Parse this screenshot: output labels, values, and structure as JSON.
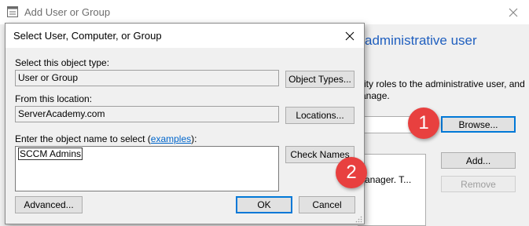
{
  "background_window": {
    "title": "Add User or Group",
    "heading": "administrative user",
    "description_line1": "rity roles to the administrative user, and",
    "description_line2": "anage.",
    "list_text": "anager. T...",
    "browse_label": "Browse...",
    "add_label": "Add...",
    "remove_label": "Remove"
  },
  "dialog": {
    "title": "Select User, Computer, or Group",
    "object_type_label": "Select this object type:",
    "object_type_value": "User or Group",
    "object_types_button": "Object Types...",
    "location_label": "From this location:",
    "location_value": "ServerAcademy.com",
    "locations_button": "Locations...",
    "names_label_prefix": "Enter the object name to select (",
    "names_label_link": "examples",
    "names_label_suffix": "):",
    "names_value": "SCCM Admins",
    "check_names_button": "Check Names",
    "advanced_button": "Advanced...",
    "ok_button": "OK",
    "cancel_button": "Cancel"
  },
  "callouts": {
    "first": "1",
    "second": "2"
  },
  "colors": {
    "accent": "#0078d7",
    "callout": "#e8403f",
    "heading": "#1f5fbf",
    "link": "#0066cc"
  },
  "icons": [
    "app-icon",
    "close-icon",
    "resize-grip-icon"
  ]
}
